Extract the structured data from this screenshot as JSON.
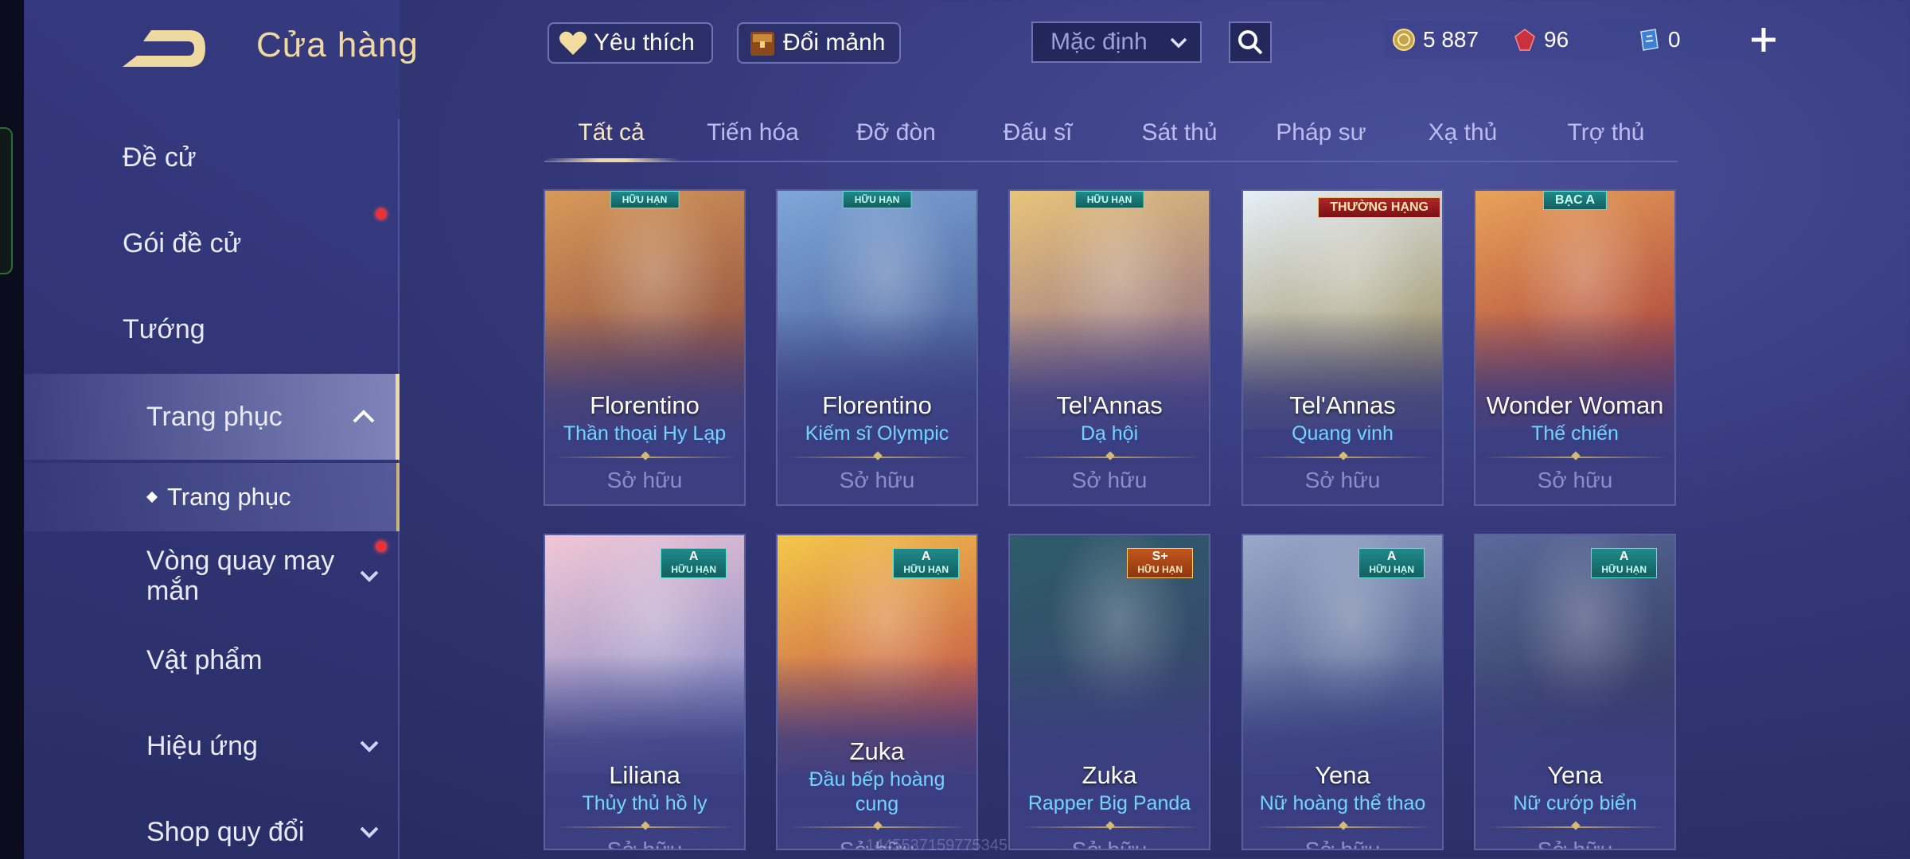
{
  "header": {
    "title": "Cửa hàng",
    "favorite_label": "Yêu thích",
    "exchange_label": "Đổi mảnh",
    "sort_value": "Mặc định",
    "currency": {
      "gold": "5 887",
      "ruby": "96",
      "voucher": "0"
    }
  },
  "sidebar": {
    "items": [
      {
        "label": "Đề cử"
      },
      {
        "label": "Gói đề cử"
      },
      {
        "label": "Tướng"
      },
      {
        "label": "Trang phục"
      },
      {
        "label": "Vòng quay may mắn"
      },
      {
        "label": "Vật phẩm"
      },
      {
        "label": "Hiệu ứng"
      },
      {
        "label": "Shop quy đổi"
      }
    ],
    "subitem": "Trang phục"
  },
  "tabs": [
    "Tất cả",
    "Tiến hóa",
    "Đỡ đòn",
    "Đấu sĩ",
    "Sát thủ",
    "Pháp sư",
    "Xạ thủ",
    "Trợ thủ"
  ],
  "owned_label": "Sở hữu",
  "cards": [
    {
      "hero": "Florentino",
      "skin": "Thần thoại Hy Lạp",
      "badge": "HỮU HẠN",
      "color_top": "#d89a5a",
      "color_bottom": "#7a3b3b"
    },
    {
      "hero": "Florentino",
      "skin": "Kiếm sĩ Olympic",
      "badge": "HỮU HẠN",
      "color_top": "#7fa7d8",
      "color_bottom": "#3d4f8a"
    },
    {
      "hero": "Tel'Annas",
      "skin": "Dạ hội",
      "badge": "HỮU HẠN",
      "color_top": "#e9c47a",
      "color_bottom": "#7b5a8a"
    },
    {
      "hero": "Tel'Annas",
      "skin": "Quang vinh",
      "badge": "THƯỜNG HẠNG",
      "color_top": "#e6eef8",
      "color_bottom": "#8b7a3d"
    },
    {
      "hero": "Wonder Woman",
      "skin": "Thế chiến",
      "badge": "BẠC A",
      "color_top": "#e9a25a",
      "color_bottom": "#9a2a34"
    },
    {
      "hero": "Liliana",
      "skin": "Thủy thủ hồ ly",
      "badge_tier": "A",
      "badge": "HỮU HẠN",
      "color_top": "#f2c7d6",
      "color_bottom": "#6e7fc2"
    },
    {
      "hero": "Zuka",
      "skin": "Đầu bếp hoàng cung",
      "badge_tier": "A",
      "badge": "HỮU HẠN",
      "color_top": "#f4c84a",
      "color_bottom": "#b8344a"
    },
    {
      "hero": "Zuka",
      "skin": "Rapper Big Panda",
      "badge_tier": "S+",
      "badge": "HỮU HẠN",
      "color_top": "#2d5c6a",
      "color_bottom": "#3c3f6e"
    },
    {
      "hero": "Yena",
      "skin": "Nữ hoàng thể thao",
      "badge_tier": "A",
      "badge": "HỮU HẠN",
      "color_top": "#9aa8c8",
      "color_bottom": "#3b4a7e"
    },
    {
      "hero": "Yena",
      "skin": "Nữ cướp biển",
      "badge_tier": "A",
      "badge": "HỮU HẠN",
      "color_top": "#5a6a9a",
      "color_bottom": "#2a2f52"
    }
  ],
  "watermark": "1445537159775345",
  "colors": {
    "accent_gold": "#f0d9a0",
    "skin_name": "#73d4ff",
    "notification": "#e8323a"
  }
}
